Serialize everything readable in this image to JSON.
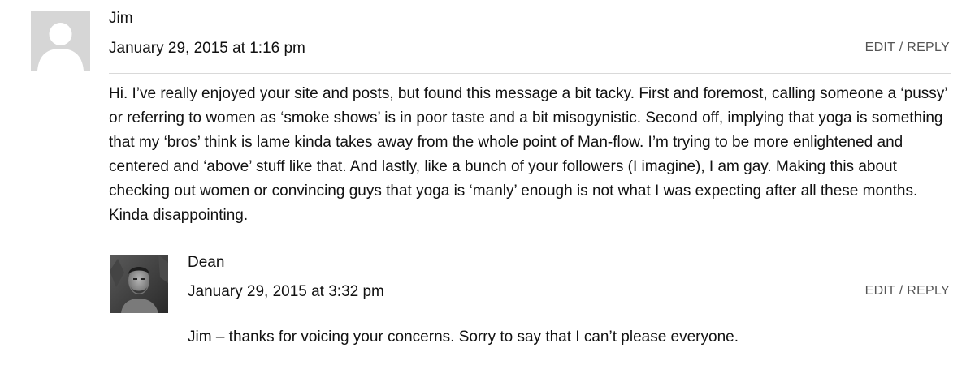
{
  "comments": [
    {
      "author": "Jim",
      "date": "January 29, 2015 at 1:16 pm",
      "actions": {
        "edit": "EDIT",
        "separator": "/",
        "reply": "REPLY"
      },
      "text": "Hi. I’ve really enjoyed your site and posts, but found this message a bit tacky. First and foremost, calling someone a ‘pussy’ or referring to women as ‘smoke shows’ is in poor taste and a bit misogynistic. Second off, implying that yoga is something that my ‘bros’ think is lame kinda takes away from the whole point of Man-flow. I’m trying to be more enlightened and centered and ‘above’ stuff like that. And lastly, like a bunch of your followers (I imagine), I am gay. Making this about checking out women or convincing guys that yoga is ‘manly’ enough is not what I was expecting after all these months. Kinda disappointing.",
      "avatar": "default-avatar-icon"
    },
    {
      "author": "Dean",
      "date": "January 29, 2015 at 3:32 pm",
      "actions": {
        "edit": "EDIT",
        "separator": "/",
        "reply": "REPLY"
      },
      "text": "Jim – thanks for voicing your concerns. Sorry to say that I can’t please everyone.",
      "avatar": "user-photo-avatar"
    }
  ],
  "colors": {
    "text": "#111111",
    "meta": "#555555",
    "divider": "#d9d9d9",
    "avatar_bg": "#d6d6d6"
  }
}
